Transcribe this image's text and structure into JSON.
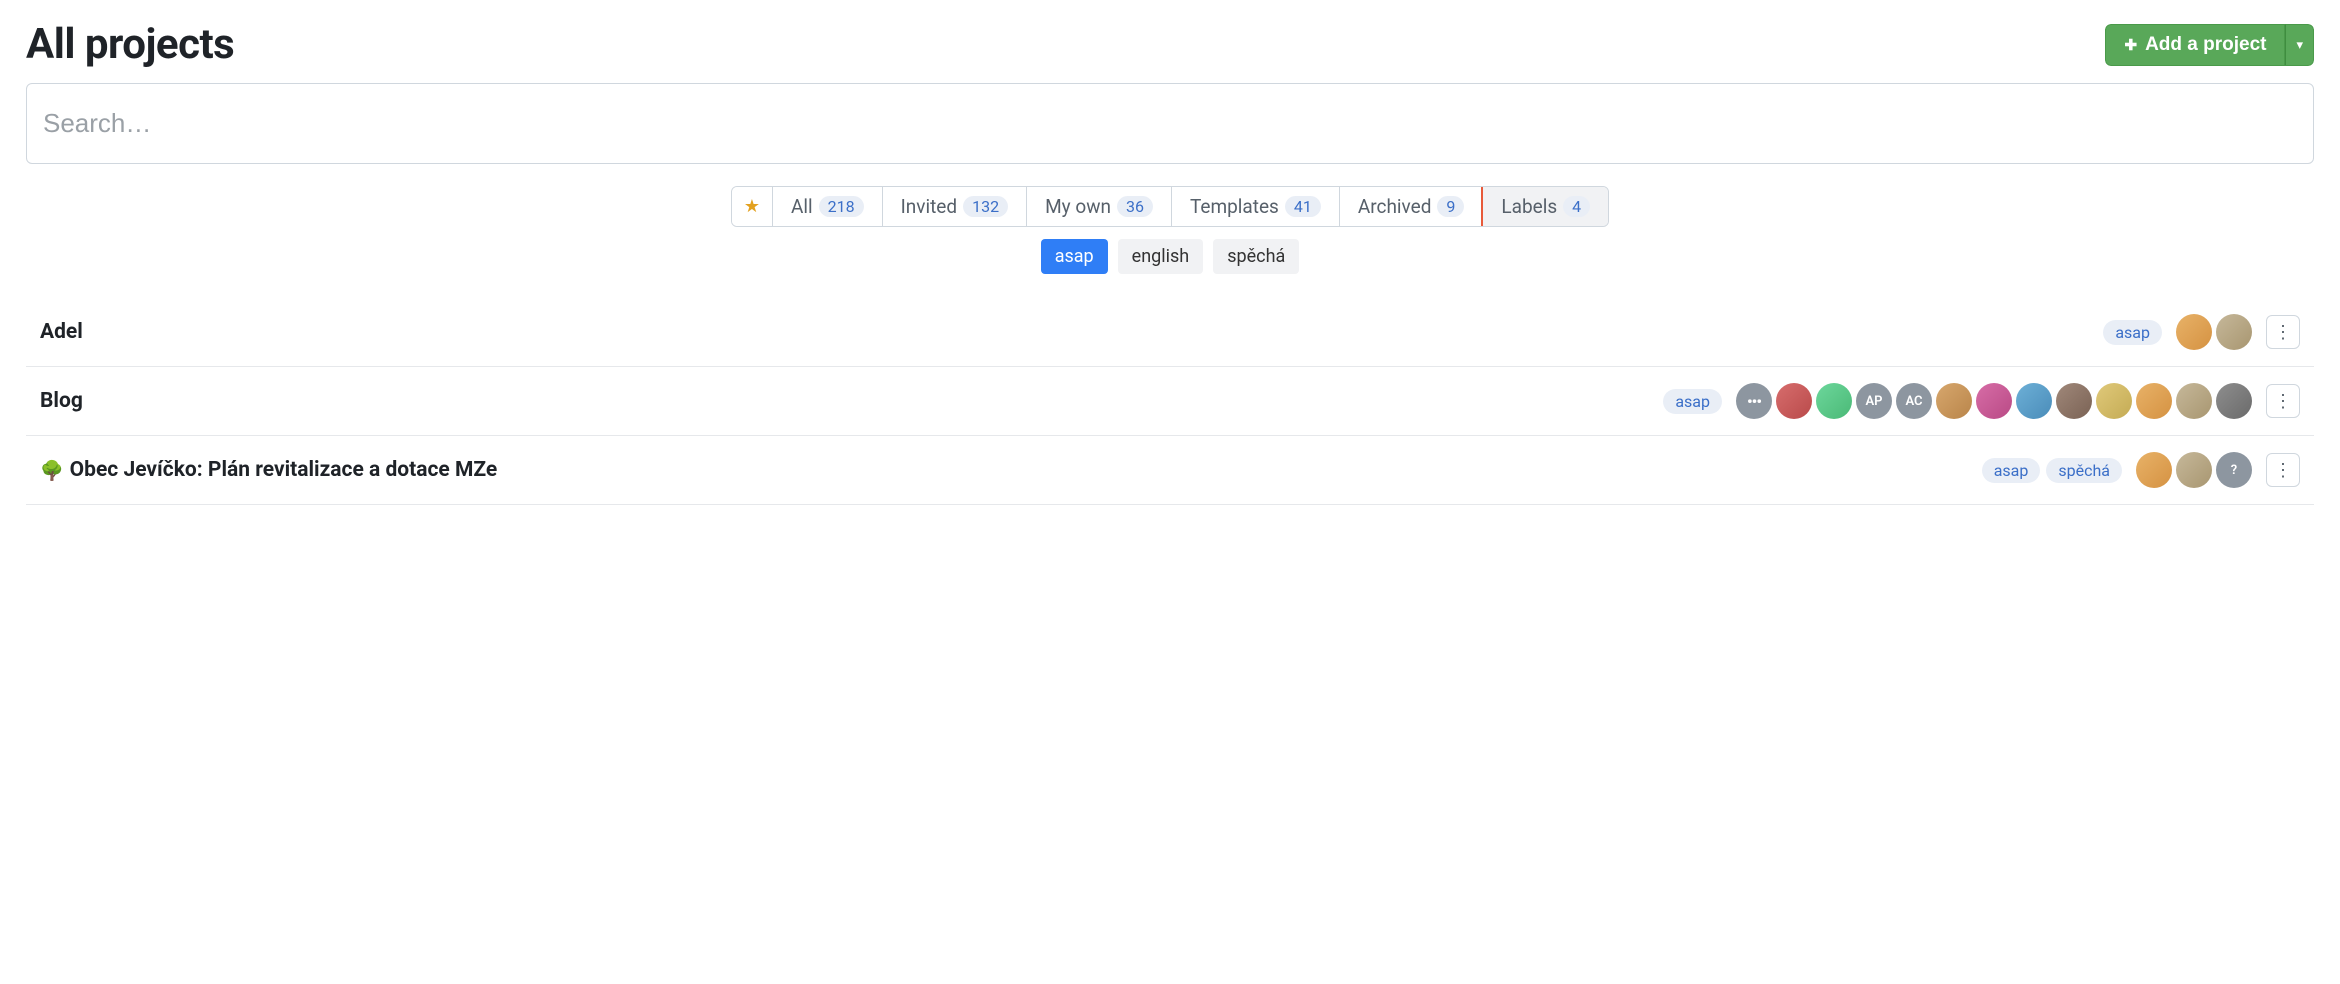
{
  "header": {
    "title": "All projects",
    "add_project_label": "Add a project"
  },
  "search": {
    "placeholder": "Search…",
    "value": ""
  },
  "filters": {
    "tabs": [
      {
        "id": "star",
        "label": "",
        "count": null,
        "icon": "star"
      },
      {
        "id": "all",
        "label": "All",
        "count": "218"
      },
      {
        "id": "invited",
        "label": "Invited",
        "count": "132"
      },
      {
        "id": "myown",
        "label": "My own",
        "count": "36"
      },
      {
        "id": "templates",
        "label": "Templates",
        "count": "41"
      },
      {
        "id": "archived",
        "label": "Archived",
        "count": "9"
      },
      {
        "id": "labels",
        "label": "Labels",
        "count": "4",
        "active": true,
        "highlighted": true
      }
    ]
  },
  "label_pills": [
    {
      "name": "asap",
      "active": true
    },
    {
      "name": "english",
      "active": false
    },
    {
      "name": "spěchá",
      "active": false
    }
  ],
  "projects": [
    {
      "name": "Adel",
      "emoji": null,
      "labels": [
        "asap"
      ],
      "avatars": [
        {
          "type": "img",
          "cls": "av-a"
        },
        {
          "type": "img",
          "cls": "av-h"
        }
      ]
    },
    {
      "name": "Blog",
      "emoji": null,
      "labels": [
        "asap"
      ],
      "avatars": [
        {
          "type": "more",
          "cls": "av-gray",
          "text": "•••"
        },
        {
          "type": "img",
          "cls": "av-b"
        },
        {
          "type": "img",
          "cls": "av-f"
        },
        {
          "type": "initials",
          "cls": "av-gray",
          "text": "AP"
        },
        {
          "type": "initials",
          "cls": "av-gray",
          "text": "AC"
        },
        {
          "type": "img",
          "cls": "av-d"
        },
        {
          "type": "img",
          "cls": "av-g"
        },
        {
          "type": "img",
          "cls": "av-c"
        },
        {
          "type": "img",
          "cls": "av-k"
        },
        {
          "type": "img",
          "cls": "av-i"
        },
        {
          "type": "img",
          "cls": "av-a"
        },
        {
          "type": "img",
          "cls": "av-h"
        },
        {
          "type": "img",
          "cls": "av-j"
        }
      ]
    },
    {
      "name": "Obec Jevíčko: Plán revitalizace a dotace MZe",
      "emoji": "🌳",
      "labels": [
        "asap",
        "spěchá"
      ],
      "avatars": [
        {
          "type": "img",
          "cls": "av-a"
        },
        {
          "type": "img",
          "cls": "av-h"
        },
        {
          "type": "initials",
          "cls": "av-gray",
          "text": "?"
        }
      ]
    }
  ]
}
